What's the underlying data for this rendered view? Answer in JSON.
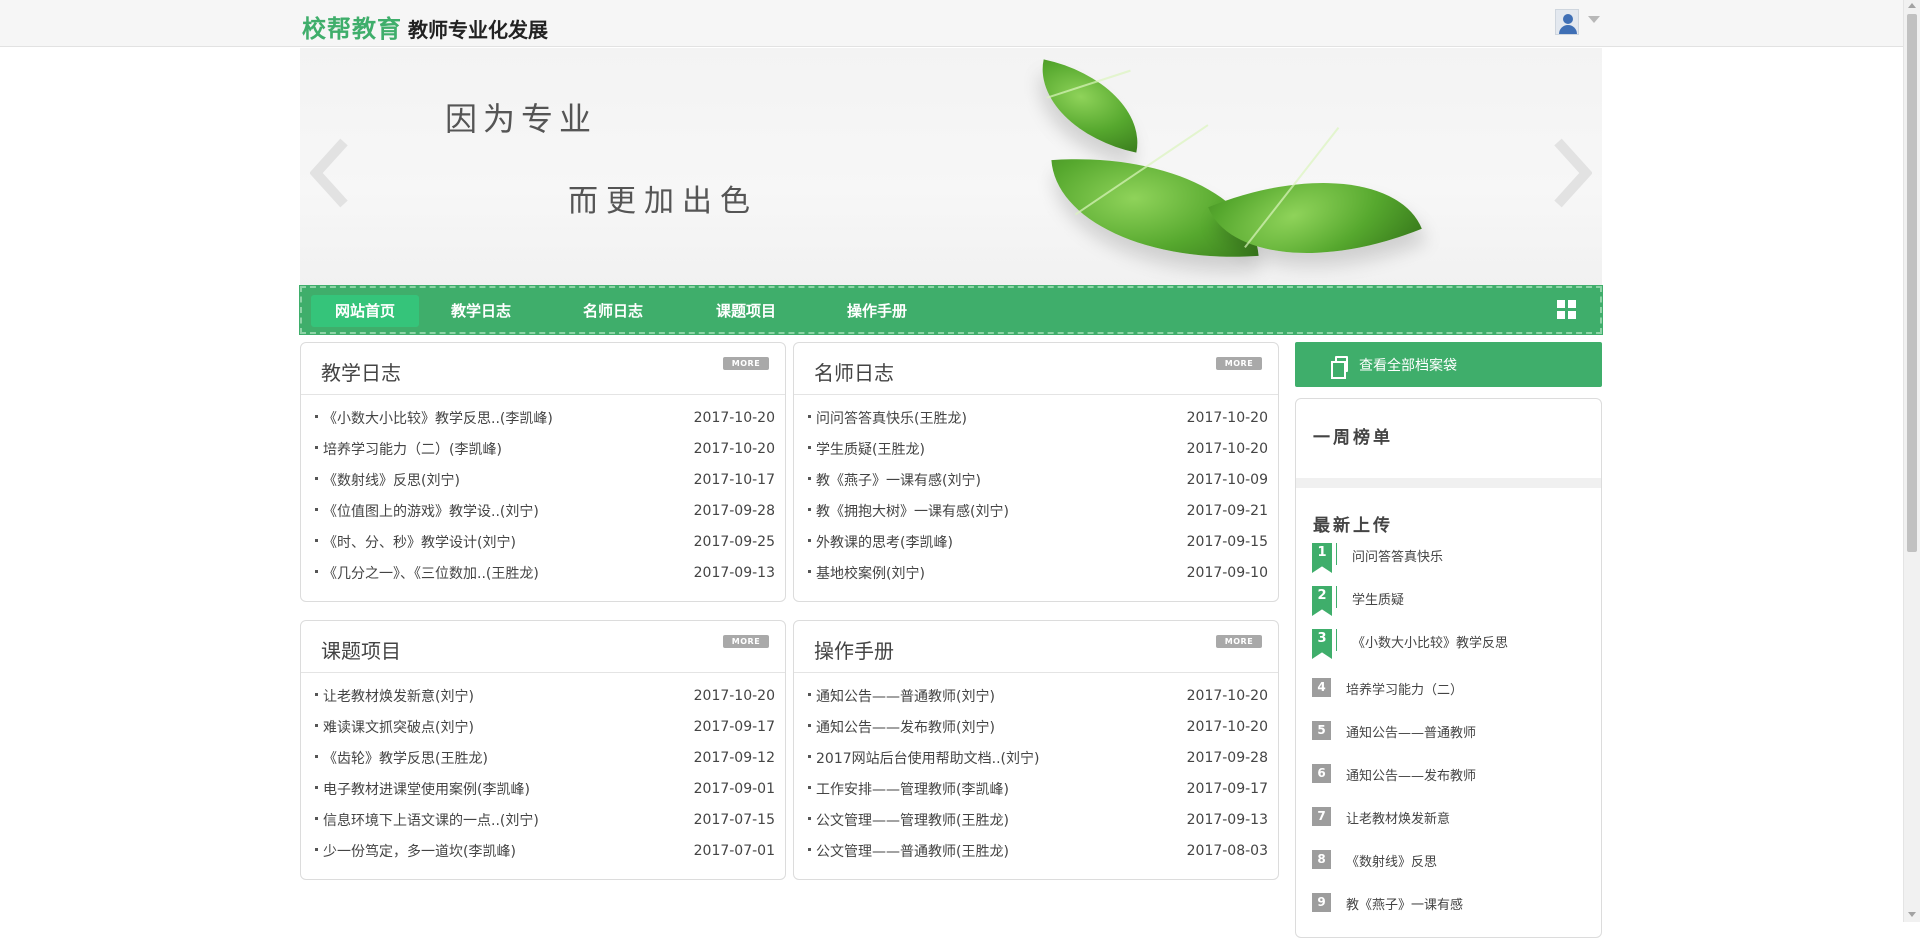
{
  "header": {
    "brand_logo": "校帮教育",
    "brand_subtitle": "教师专业化发展"
  },
  "banner": {
    "line1": "因为专业",
    "line2": "而更加出色"
  },
  "nav": {
    "items": [
      "网站首页",
      "教学日志",
      "名师日志",
      "课题项目",
      "操作手册"
    ],
    "active_index": 0
  },
  "panels": {
    "teaching_log": {
      "title": "教学日志",
      "more": "MORE",
      "rows": [
        {
          "text": "《小数大小比较》教学反思..(李凯峰)",
          "date": "2017-10-20"
        },
        {
          "text": "培养学习能力（二）(李凯峰)",
          "date": "2017-10-20"
        },
        {
          "text": "《数射线》反思(刘宁)",
          "date": "2017-10-17"
        },
        {
          "text": "《位值图上的游戏》教学设..(刘宁)",
          "date": "2017-09-28"
        },
        {
          "text": "《时、分、秒》教学设计(刘宁)",
          "date": "2017-09-25"
        },
        {
          "text": "《几分之一》、《三位数加..(王胜龙)",
          "date": "2017-09-13"
        }
      ]
    },
    "master_log": {
      "title": "名师日志",
      "more": "MORE",
      "rows": [
        {
          "text": "问问答答真快乐(王胜龙)",
          "date": "2017-10-20"
        },
        {
          "text": "学生质疑(王胜龙)",
          "date": "2017-10-20"
        },
        {
          "text": "教《燕子》一课有感(刘宁)",
          "date": "2017-10-09"
        },
        {
          "text": "教《拥抱大树》一课有感(刘宁)",
          "date": "2017-09-21"
        },
        {
          "text": "外教课的思考(李凯峰)",
          "date": "2017-09-15"
        },
        {
          "text": "基地校案例(刘宁)",
          "date": "2017-09-10"
        }
      ]
    },
    "projects": {
      "title": "课题项目",
      "more": "MORE",
      "rows": [
        {
          "text": "让老教材焕发新意(刘宁)",
          "date": "2017-10-20"
        },
        {
          "text": "难读课文抓突破点(刘宁)",
          "date": "2017-09-17"
        },
        {
          "text": "《齿轮》教学反思(王胜龙)",
          "date": "2017-09-12"
        },
        {
          "text": "电子教材进课堂使用案例(李凯峰)",
          "date": "2017-09-01"
        },
        {
          "text": "信息环境下上语文课的一点..(刘宁)",
          "date": "2017-07-15"
        },
        {
          "text": "少一份笃定，多一道坎(李凯峰)",
          "date": "2017-07-01"
        }
      ]
    },
    "manual": {
      "title": "操作手册",
      "more": "MORE",
      "rows": [
        {
          "text": "通知公告——普通教师(刘宁)",
          "date": "2017-10-20"
        },
        {
          "text": "通知公告——发布教师(刘宁)",
          "date": "2017-10-20"
        },
        {
          "text": "2017网站后台使用帮助文档..(刘宁)",
          "date": "2017-09-28"
        },
        {
          "text": "工作安排——管理教师(李凯峰)",
          "date": "2017-09-17"
        },
        {
          "text": "公文管理——管理教师(王胜龙)",
          "date": "2017-09-13"
        },
        {
          "text": "公文管理——普通教师(王胜龙)",
          "date": "2017-08-03"
        }
      ]
    }
  },
  "sidebar": {
    "archive_button": "查看全部档案袋",
    "week_title": "一周榜单",
    "new_title": "最新上传",
    "new_items": [
      {
        "rank": "1",
        "text": "问问答答真快乐"
      },
      {
        "rank": "2",
        "text": "学生质疑"
      },
      {
        "rank": "3",
        "text": "《小数大小比较》教学反思"
      },
      {
        "rank": "4",
        "text": "培养学习能力（二）"
      },
      {
        "rank": "5",
        "text": "通知公告——普通教师"
      },
      {
        "rank": "6",
        "text": "通知公告——发布教师"
      },
      {
        "rank": "7",
        "text": "让老教材焕发新意"
      },
      {
        "rank": "8",
        "text": "《数射线》反思"
      },
      {
        "rank": "9",
        "text": "教《燕子》一课有感"
      }
    ]
  },
  "colors": {
    "brand_green": "#3fae6b",
    "active_nav": "#35c47a",
    "badge_gray": "#9d9d9d"
  }
}
